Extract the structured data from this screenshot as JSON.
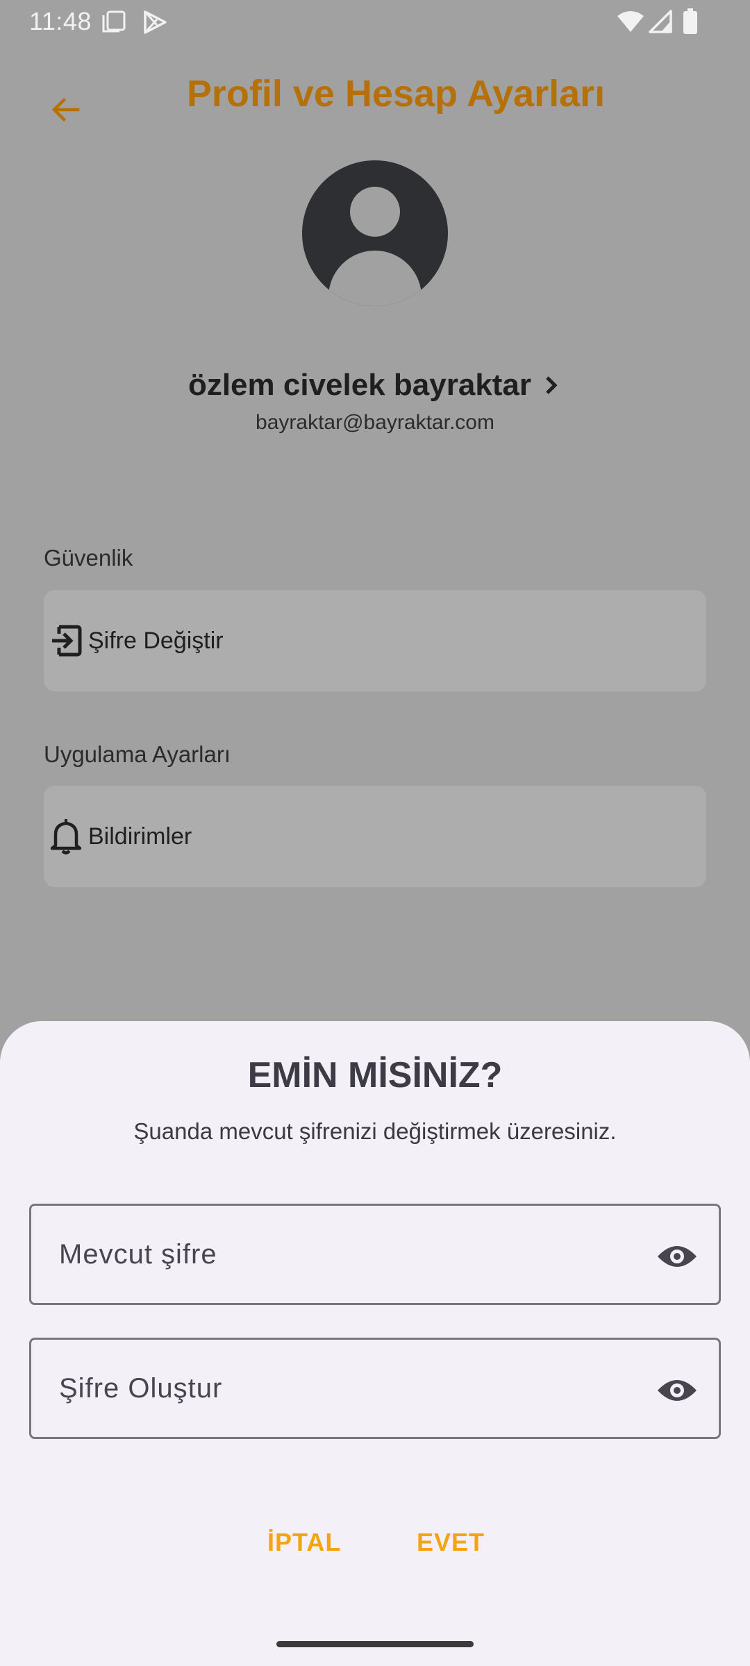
{
  "status_bar": {
    "time": "11:48"
  },
  "header": {
    "title": "Profil ve Hesap Ayarları"
  },
  "profile": {
    "name": "özlem civelek bayraktar",
    "email": "bayraktar@bayraktar.com"
  },
  "sections": {
    "security": {
      "label": "Güvenlik",
      "item": "Şifre Değiştir"
    },
    "app_settings": {
      "label": "Uygulama Ayarları",
      "item": "Bildirimler"
    }
  },
  "dialog": {
    "title": "EMİN MİSİNİZ?",
    "subtitle": "Şuanda mevcut şifrenizi değiştirmek üzeresiniz.",
    "current_password_placeholder": "Mevcut şifre",
    "new_password_placeholder": "Şifre Oluştur",
    "cancel_label": "İPTAL",
    "confirm_label": "EVET"
  },
  "colors": {
    "accent": "#b57008",
    "button_text": "#f3a40e",
    "sheet_bg": "#f4f0f7",
    "scrim_bg": "#a1a1a1"
  }
}
